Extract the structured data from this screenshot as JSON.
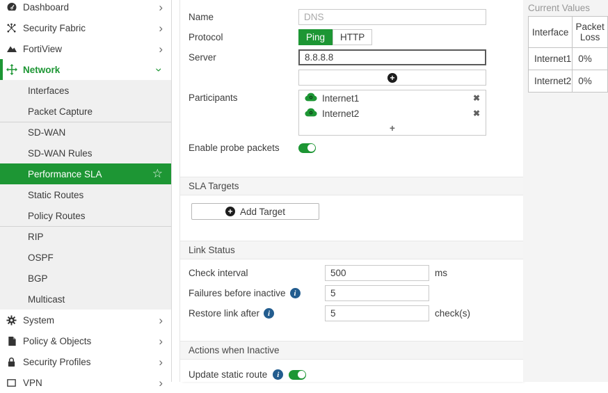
{
  "theme": {
    "accent_green": "#1d9634",
    "selected_row_bg": "#1d9634",
    "info_icon_blue": "#235d8f",
    "section_band_bg": "#f5f5f5",
    "submenu_bg": "#f0f0f0"
  },
  "icons": {
    "chevron_right": "›",
    "chevron_down": "›",
    "star": "☆",
    "plus": "+",
    "remove_x": "✖",
    "info": "i"
  },
  "sidebar": {
    "top_items": [
      {
        "label": "Dashboard"
      },
      {
        "label": "Security Fabric"
      },
      {
        "label": "FortiView"
      },
      {
        "label": "Network"
      },
      {
        "label": "System"
      },
      {
        "label": "Policy & Objects"
      },
      {
        "label": "Security Profiles"
      },
      {
        "label": "VPN"
      }
    ],
    "network_submenu": {
      "group1": [
        "Interfaces",
        "Packet Capture"
      ],
      "group2": [
        "SD-WAN",
        "SD-WAN Rules",
        "Performance SLA",
        "Static Routes",
        "Policy Routes"
      ],
      "group3": [
        "RIP",
        "OSPF",
        "BGP",
        "Multicast"
      ],
      "selected": "Performance SLA"
    }
  },
  "form": {
    "name": {
      "label": "Name",
      "placeholder": "DNS",
      "value": ""
    },
    "protocol": {
      "label": "Protocol",
      "options": [
        "Ping",
        "HTTP"
      ],
      "selected": "Ping"
    },
    "server": {
      "label": "Server",
      "value": "8.8.8.8"
    },
    "participants": {
      "label": "Participants",
      "items": [
        "Internet1",
        "Internet2"
      ]
    },
    "enable_probe_packets": {
      "label": "Enable probe packets",
      "enabled": true
    },
    "sla_targets": {
      "section_title": "SLA Targets",
      "add_button_label": "Add Target"
    },
    "link_status": {
      "section_title": "Link Status",
      "check_interval": {
        "label": "Check interval",
        "value": "500",
        "unit": "ms"
      },
      "failures_before_inactive": {
        "label": "Failures before inactive",
        "value": "5"
      },
      "restore_link_after": {
        "label": "Restore link after",
        "value": "5",
        "unit": "check(s)"
      }
    },
    "actions_when_inactive": {
      "section_title": "Actions when Inactive",
      "update_static_route": {
        "label": "Update static route",
        "enabled": true
      }
    }
  },
  "current_values": {
    "title": "Current Values",
    "columns": [
      "Interface",
      "Packet Loss"
    ],
    "rows": [
      [
        "Internet1",
        "0%"
      ],
      [
        "Internet2",
        "0%"
      ]
    ]
  }
}
